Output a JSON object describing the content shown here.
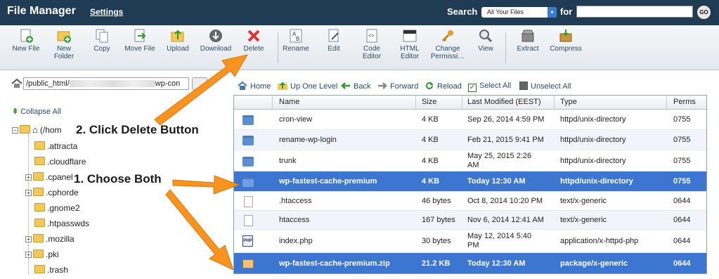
{
  "header": {
    "title": "File Manager",
    "settings_link": "Settings",
    "search_label": "Search",
    "scope_value": "All Your Files",
    "for_label": "for",
    "search_value": "",
    "go_label": "GO"
  },
  "toolbar": {
    "new_file": "New File",
    "new_folder": "New\nFolder",
    "copy": "Copy",
    "move_file": "Move File",
    "upload": "Upload",
    "download": "Download",
    "delete": "Delete",
    "rename": "Rename",
    "edit": "Edit",
    "code_editor": "Code\nEditor",
    "html_editor": "HTML\nEditor",
    "change_permissions": "Change\nPermissi…",
    "view": "View",
    "extract": "Extract",
    "compress": "Compress"
  },
  "path": {
    "prefix": "/public_html/",
    "suffix": "wp-con"
  },
  "nav": {
    "home": "Home",
    "up": "Up One Level",
    "back": "Back",
    "forward": "Forward",
    "reload": "Reload",
    "select_all": "Select All",
    "unselect_all": "Unselect All"
  },
  "tree": {
    "collapse_all": "Collapse All",
    "root": "(/hom",
    "items": [
      ".attracta",
      ".cloudflare",
      ".cpanel",
      ".cphorde",
      ".gnome2",
      ".htpasswds",
      ".mozilla",
      ".pki",
      ".trash"
    ]
  },
  "table": {
    "headers": {
      "name": "Name",
      "size": "Size",
      "modified": "Last Modified (EEST)",
      "type": "Type",
      "perms": "Perms"
    },
    "rows": [
      {
        "name": "cron-view",
        "size": "4 KB",
        "modified": "Sep 26, 2014 4:59 PM",
        "type": "httpd/unix-directory",
        "perms": "0755",
        "icon": "folder-icon"
      },
      {
        "name": "rename-wp-login",
        "size": "4 KB",
        "modified": "Feb 21, 2015 9:41 PM",
        "type": "httpd/unix-directory",
        "perms": "0755",
        "icon": "folder-icon"
      },
      {
        "name": "trunk",
        "size": "4 KB",
        "modified": "May 25, 2015 2:26\nAM",
        "type": "httpd/unix-directory",
        "perms": "0755",
        "icon": "folder-icon"
      },
      {
        "name": "wp-fastest-cache-premium",
        "size": "4 KB",
        "modified": "Today 12:30 AM",
        "type": "httpd/unix-directory",
        "perms": "0755",
        "icon": "folder-icon"
      },
      {
        "name": ".htaccess",
        "size": "46 bytes",
        "modified": "Oct 8, 2014 10:20 PM",
        "type": "text/x-generic",
        "perms": "0644",
        "icon": "text-file-icon"
      },
      {
        "name": "htaccess",
        "size": "167 bytes",
        "modified": "Nov 6, 2014 12:41 AM",
        "type": "text/x-generic",
        "perms": "0644",
        "icon": "text-file-icon"
      },
      {
        "name": "index.php",
        "size": "30 bytes",
        "modified": "May 12, 2014 5:40\nPM",
        "type": "application/x-httpd-php",
        "perms": "0644",
        "icon": "php-file-icon"
      },
      {
        "name": "wp-fastest-cache-premium.zip",
        "size": "21.2 KB",
        "modified": "Today 12:30 AM",
        "type": "package/x-generic",
        "perms": "0644",
        "icon": "archive-icon"
      }
    ]
  },
  "annotations": {
    "step1": "1. Choose Both",
    "step2": "2. Click Delete Button"
  },
  "colors": {
    "header_bg": "#1f3c54",
    "selected_row": "#3c76d1",
    "arrow": "#f7931e"
  }
}
